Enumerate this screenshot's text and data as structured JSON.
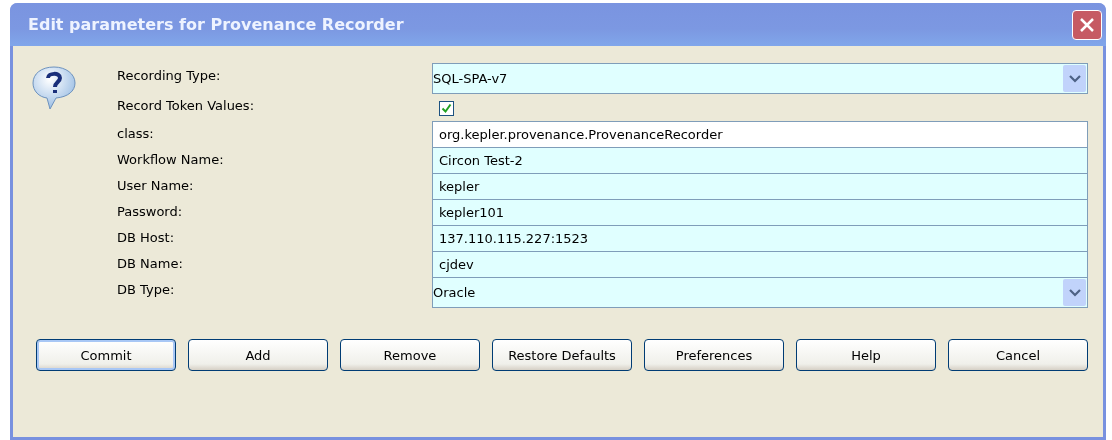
{
  "window": {
    "title": "Edit parameters for Provenance Recorder"
  },
  "params": [
    {
      "label": "Recording Type:",
      "kind": "combo",
      "value": "SQL-SPA-v7"
    },
    {
      "label": "Record Token Values:",
      "kind": "checkbox",
      "checked": true
    },
    {
      "label": "class:",
      "kind": "plain",
      "value": "org.kepler.provenance.ProvenanceRecorder"
    },
    {
      "label": "Workflow Name:",
      "kind": "text",
      "value": "Circon Test-2"
    },
    {
      "label": "User Name:",
      "kind": "text",
      "value": "kepler"
    },
    {
      "label": "Password:",
      "kind": "text",
      "value": "kepler101"
    },
    {
      "label": "DB Host:",
      "kind": "text",
      "value": "137.110.115.227:1523"
    },
    {
      "label": "DB Name:",
      "kind": "text",
      "value": "cjdev"
    },
    {
      "label": "DB Type:",
      "kind": "combo",
      "value": "Oracle"
    }
  ],
  "buttons": [
    {
      "label": "Commit",
      "focused": true
    },
    {
      "label": "Add",
      "focused": false
    },
    {
      "label": "Remove",
      "focused": false
    },
    {
      "label": "Restore Defaults",
      "focused": false
    },
    {
      "label": "Preferences",
      "focused": false
    },
    {
      "label": "Help",
      "focused": false
    },
    {
      "label": "Cancel",
      "focused": false
    }
  ]
}
